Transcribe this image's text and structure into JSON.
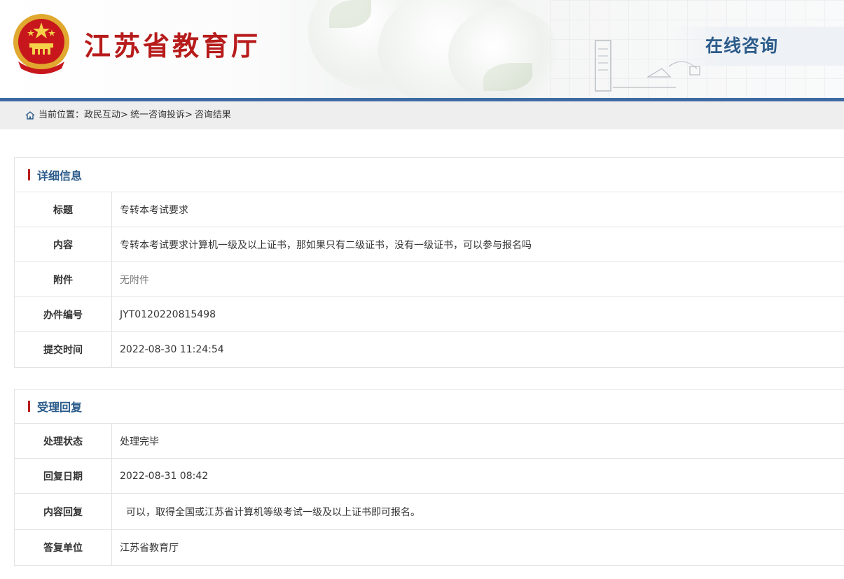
{
  "header": {
    "site_title": "江苏省教育厅",
    "zone_label": "在线咨询"
  },
  "breadcrumb": {
    "prefix": "当前位置：",
    "items": [
      "政民互动",
      "统一咨询投诉",
      "咨询结果"
    ],
    "separator": ">"
  },
  "detail": {
    "title": "详细信息",
    "rows": [
      {
        "label": "标题",
        "value": "专转本考试要求"
      },
      {
        "label": "内容",
        "value": "专转本考试要求计算机一级及以上证书，那如果只有二级证书，没有一级证书，可以参与报名吗"
      },
      {
        "label": "附件",
        "value": "无附件"
      },
      {
        "label": "办件编号",
        "value": "JYT0120220815498"
      },
      {
        "label": "提交时间",
        "value": "2022-08-30 11:24:54"
      }
    ]
  },
  "reply": {
    "title": "受理回复",
    "rows": [
      {
        "label": "处理状态",
        "value": "处理完毕"
      },
      {
        "label": "回复日期",
        "value": "2022-08-31 08:42"
      },
      {
        "label": "内容回复",
        "value": "可以，取得全国或江苏省计算机等级考试一级及以上证书即可报名。"
      },
      {
        "label": "答复单位",
        "value": "江苏省教育厅"
      }
    ]
  },
  "colors": {
    "brand_red": "#b71c1c",
    "brand_blue": "#2b5b8a",
    "bar_blue": "#3d6aa3"
  }
}
